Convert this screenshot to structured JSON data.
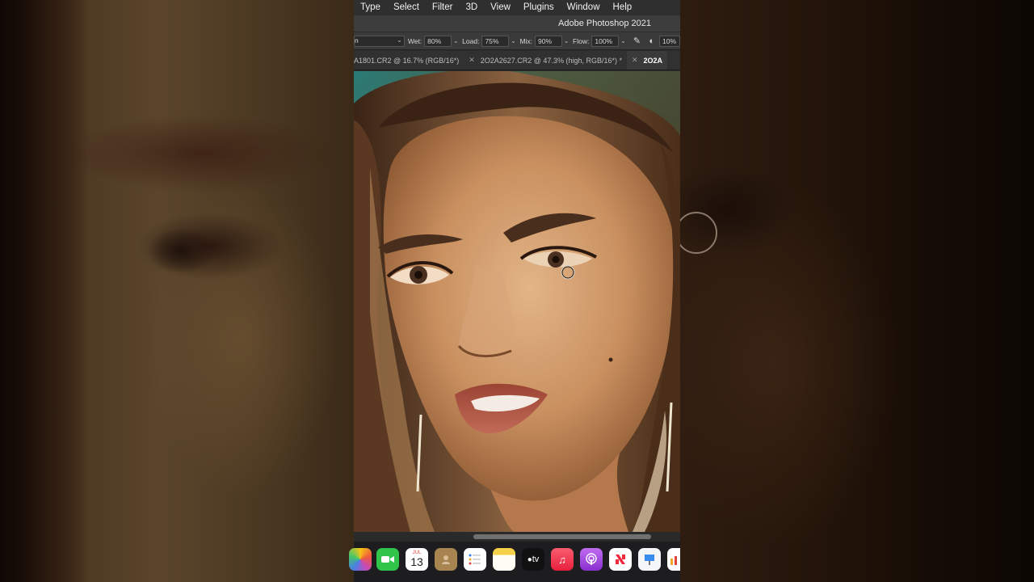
{
  "menubar": {
    "items": [
      "Type",
      "Select",
      "Filter",
      "3D",
      "View",
      "Plugins",
      "Window",
      "Help"
    ]
  },
  "window": {
    "title": "Adobe Photoshop 2021"
  },
  "options": {
    "select_value": "n",
    "wet_label": "Wet:",
    "wet_value": "80%",
    "load_label": "Load:",
    "load_value": "75%",
    "mix_label": "Mix:",
    "mix_value": "90%",
    "flow_label": "Flow:",
    "flow_value": "100%",
    "pressure_value": "10%"
  },
  "tabs": [
    {
      "label": "A1801.CR2 @ 16.7% (RGB/16*)",
      "active": false
    },
    {
      "label": "2O2A2627.CR2 @ 47.3% (high, RGB/16*) *",
      "active": false
    },
    {
      "label": "2O2A",
      "active": true
    }
  ],
  "dock": {
    "calendar_month": "JUL",
    "calendar_day": "13",
    "tv_label": "tv",
    "apps": [
      "photos-icon",
      "facetime-icon",
      "calendar-icon",
      "contacts-icon",
      "reminders-icon",
      "notes-icon",
      "apple-tv-icon",
      "music-icon",
      "podcasts-icon",
      "news-icon",
      "keynote-icon",
      "numbers-icon"
    ]
  },
  "colors": {
    "menubar_bg": "#2f2f2f",
    "panel_bg": "#3a3a3a",
    "dock_bg": "#1d1d1f"
  }
}
